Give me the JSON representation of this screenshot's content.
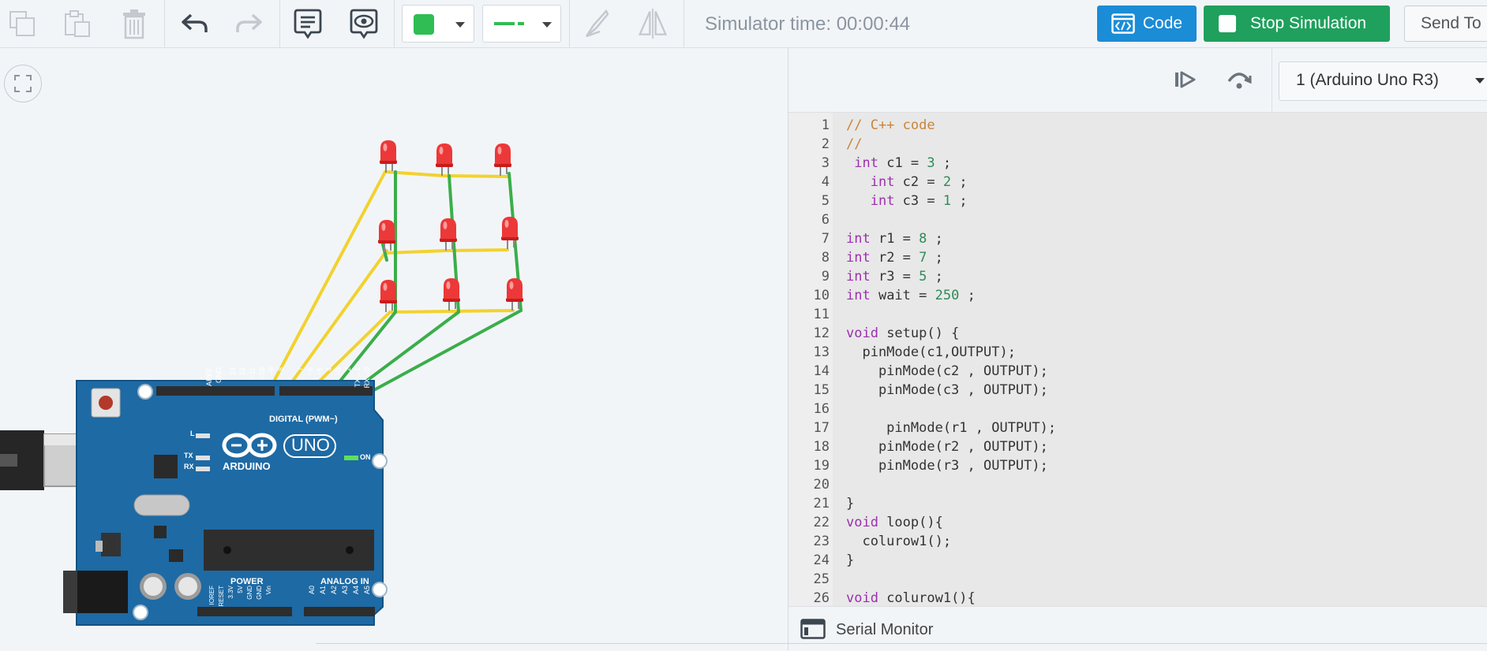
{
  "toolbar": {
    "sim_time": "Simulator time: 00:00:44",
    "code_label": "Code",
    "stop_label": "Stop Simulation",
    "send_label": "Send To",
    "wire_color": "#2fbd54",
    "icons": [
      "copy-icon",
      "paste-icon",
      "delete-icon",
      "undo-icon",
      "redo-icon",
      "notes-icon",
      "view-icon",
      "color-swatch",
      "wire-style",
      "annotate-icon",
      "flip-icon"
    ]
  },
  "board": {
    "name": "UNO",
    "brand": "ARDUINO",
    "digital_label": "DIGITAL (PWM~)",
    "power_label": "POWER",
    "analog_label": "ANALOG IN",
    "on_label": "ON",
    "l_label": "L",
    "tx_label": "TX",
    "rx_label": "RX",
    "top_pins": [
      "AREF",
      "GND",
      "13",
      "12",
      "~11",
      "~10",
      "~9",
      "8",
      "7",
      "~6",
      "~5",
      "4",
      "~3",
      "2",
      "TX→1",
      "RX←0"
    ],
    "power_pins": [
      "IOREF",
      "RESET",
      "3.3V",
      "5V",
      "GND",
      "GND",
      "Vin"
    ],
    "analog_pins": [
      "A0",
      "A1",
      "A2",
      "A3",
      "A4",
      "A5"
    ]
  },
  "code_panel": {
    "device": "1 (Arduino Uno R3)",
    "serial_monitor": "Serial Monitor",
    "lines": [
      "// C++ code",
      "//",
      " int c1 = 3 ;",
      "   int c2 = 2 ;",
      "   int c3 = 1 ;",
      "",
      "int r1 = 8 ;",
      "int r2 = 7 ;",
      "int r3 = 5 ;",
      "int wait = 250 ;",
      "",
      "void setup() {",
      "  pinMode(c1,OUTPUT);",
      "    pinMode(c2 , OUTPUT);",
      "    pinMode(c3 , OUTPUT);",
      "",
      "     pinMode(r1 , OUTPUT);",
      "    pinMode(r2 , OUTPUT);",
      "    pinMode(r3 , OUTPUT);",
      "",
      "}",
      "void loop(){",
      "  colurow1();",
      "}",
      "",
      "void colurow1(){"
    ]
  }
}
